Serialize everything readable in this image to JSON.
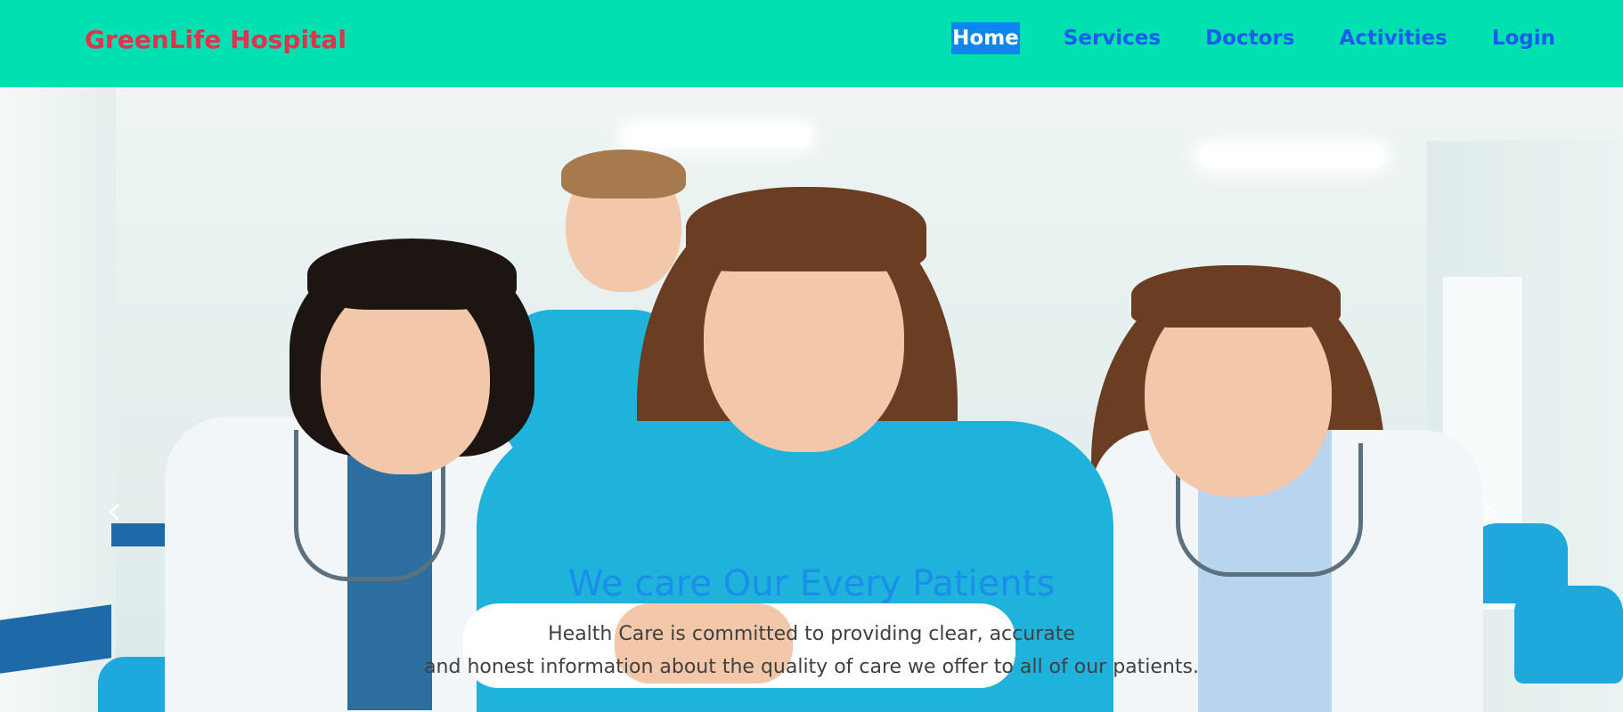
{
  "navbar": {
    "brand": "GreenLife Hospital",
    "links": [
      {
        "label": "Home",
        "active": true
      },
      {
        "label": "Services",
        "active": false
      },
      {
        "label": "Doctors",
        "active": false
      },
      {
        "label": "Activities",
        "active": false
      },
      {
        "label": "Login",
        "active": false
      }
    ]
  },
  "hero": {
    "title": "We care Our Every Patients",
    "line1": "Health Care is committed to providing clear, accurate",
    "line2": "and honest information about the quality of care we offer to all of our patients."
  },
  "icons": {
    "prev": "chevron-left-icon",
    "next": "chevron-right-icon"
  },
  "colors": {
    "navbar_bg": "#00e0b0",
    "brand": "#e0334d",
    "nav_link": "#1a5cf0",
    "active_bg": "#0d86ee",
    "caption_title": "#1a8ee8"
  }
}
